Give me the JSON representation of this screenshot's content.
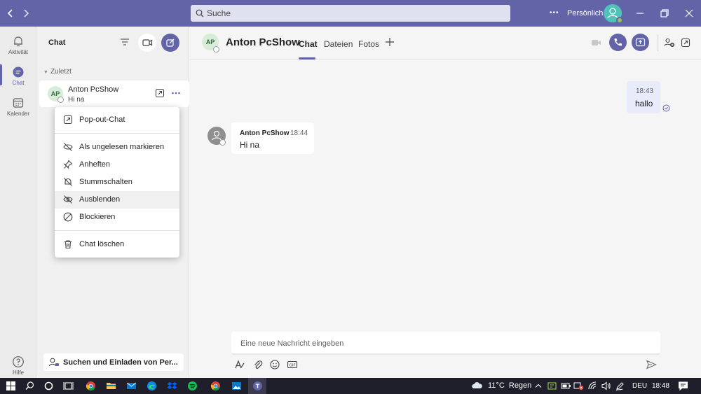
{
  "titlebar": {
    "search_placeholder": "Suche",
    "more_label": "•••",
    "account_label": "Persönlich"
  },
  "rail": {
    "items": [
      {
        "label": "Aktivität",
        "icon": "bell-icon"
      },
      {
        "label": "Chat",
        "icon": "chat-icon"
      },
      {
        "label": "Kalender",
        "icon": "calendar-icon"
      }
    ],
    "help_label": "Hilfe"
  },
  "chatlist": {
    "title": "Chat",
    "section_label": "Zuletzt",
    "items": [
      {
        "initials": "AP",
        "name": "Anton PcShow",
        "preview": "Hi na"
      }
    ],
    "invite_label": "Suchen und Einladen von Per..."
  },
  "context_menu": {
    "items": [
      {
        "label": "Pop-out-Chat",
        "icon": "popout-icon"
      },
      {
        "label": "Als ungelesen markieren",
        "icon": "unread-icon"
      },
      {
        "label": "Anheften",
        "icon": "pin-icon"
      },
      {
        "label": "Stummschalten",
        "icon": "mute-icon"
      },
      {
        "label": "Ausblenden",
        "icon": "hide-icon"
      },
      {
        "label": "Blockieren",
        "icon": "block-icon"
      },
      {
        "label": "Chat löschen",
        "icon": "trash-icon"
      }
    ]
  },
  "conversation": {
    "initials": "AP",
    "name": "Anton PcShow",
    "tabs": [
      "Chat",
      "Dateien",
      "Fotos"
    ],
    "active_tab": "Chat",
    "messages": [
      {
        "from": "me",
        "time": "18:43",
        "text": "hallo"
      },
      {
        "from": "Anton PcShow",
        "time": "18:44",
        "text": "Hi na"
      }
    ],
    "compose_placeholder": "Eine neue Nachricht eingeben"
  },
  "taskbar": {
    "weather": "11°C  Regen",
    "language": "DEU",
    "clock": "18:48"
  },
  "colors": {
    "brand": "#6264a7",
    "avatar_bg": "#d8ecd9"
  }
}
